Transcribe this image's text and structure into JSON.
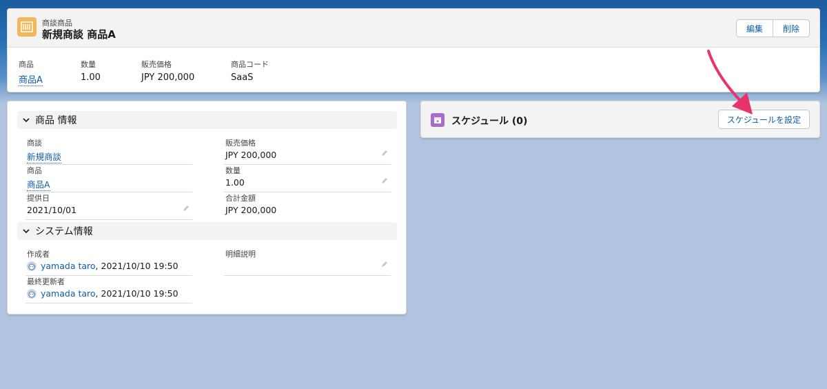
{
  "header": {
    "object_type": "商談商品",
    "title": "新規商談 商品A",
    "edit_label": "編集",
    "delete_label": "削除",
    "highlights": [
      {
        "label": "商品",
        "value": "商品A",
        "link": true
      },
      {
        "label": "数量",
        "value": "1.00",
        "link": false
      },
      {
        "label": "販売価格",
        "value": "JPY 200,000",
        "link": false
      },
      {
        "label": "商品コード",
        "value": "SaaS",
        "link": false
      }
    ]
  },
  "detail": {
    "section1_title": "商品 情報",
    "section2_title": "システム情報",
    "fields": {
      "opportunity_label": "商談",
      "opportunity_value": "新規商談",
      "sales_price_label": "販売価格",
      "sales_price_value": "JPY 200,000",
      "product_label": "商品",
      "product_value": "商品A",
      "quantity_label": "数量",
      "quantity_value": "1.00",
      "service_date_label": "提供日",
      "service_date_value": "2021/10/01",
      "total_label": "合計金額",
      "total_value": "JPY 200,000",
      "created_by_label": "作成者",
      "created_by_user": "yamada taro",
      "created_by_time": ", 2021/10/10 19:50",
      "description_label": "明細説明",
      "description_value": "",
      "modified_by_label": "最終更新者",
      "modified_by_user": "yamada taro",
      "modified_by_time": ", 2021/10/10 19:50"
    }
  },
  "schedule": {
    "title": "スケジュール (0)",
    "button_label": "スケジュールを設定"
  },
  "colors": {
    "link": "#0b5cab",
    "object_icon": "#f2b65b",
    "schedule_icon": "#a86cc9",
    "arrow": "#e8336b"
  }
}
